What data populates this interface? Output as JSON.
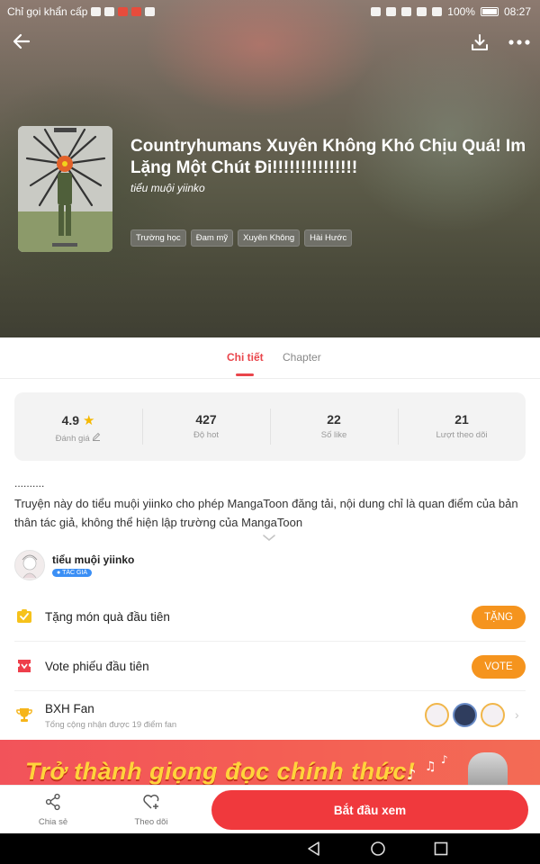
{
  "status_bar": {
    "left_text": "Chỉ gọi khẩn cấp",
    "battery": "100%",
    "time": "08:27"
  },
  "hero": {
    "title": "Countryhumans Xuyên Không Khó Chịu Quá! Im Lặng Một Chút Đi!!!!!!!!!!!!!!!",
    "author": "tiểu muội yiinko",
    "tags": [
      "Trường học",
      "Đam mỹ",
      "Xuyên Không",
      "Hài Hước"
    ]
  },
  "tabs": [
    {
      "label": "Chi tiết",
      "active": true
    },
    {
      "label": "Chapter",
      "active": false
    }
  ],
  "stats": [
    {
      "value": "4.9",
      "label": "Đánh giá"
    },
    {
      "value": "427",
      "label": "Độ hot"
    },
    {
      "value": "22",
      "label": "Số like"
    },
    {
      "value": "21",
      "label": "Lượt theo dõi"
    }
  ],
  "description": {
    "dots": "..........",
    "text": "Truyện này do tiểu muội yiinko cho phép MangaToon đăng tải, nội dung chỉ là quan điểm của bản thân tác giả, không thể hiện lập trường của MangaToon"
  },
  "author_row": {
    "name": "tiểu muội yiinko",
    "badge": "TÁC GIẢ"
  },
  "gift_row": {
    "label": "Tặng món quà đầu tiên",
    "button": "TẶNG"
  },
  "vote_row": {
    "label": "Vote phiếu đầu tiên",
    "button": "VOTE"
  },
  "fan_row": {
    "title": "BXH Fan",
    "subtitle": "Tổng cộng nhận được 19 điểm fan"
  },
  "banner": {
    "text": "Trở thành giọng đọc chính thức!"
  },
  "bottom_bar": {
    "share_label": "Chia sẻ",
    "follow_label": "Theo dõi",
    "start_label": "Bắt đầu xem"
  },
  "colors": {
    "accent": "#e9454b",
    "orange_button": "#f5941e",
    "start_button": "#f0393d",
    "badge_blue": "#3b8ff5"
  }
}
